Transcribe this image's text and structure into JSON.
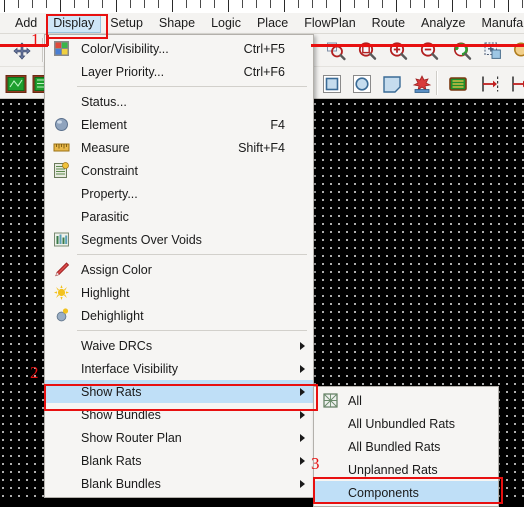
{
  "app": {
    "type": "pcb-layout-editor"
  },
  "menubar": {
    "items": [
      {
        "label": "Add",
        "active": false
      },
      {
        "label": "Display",
        "active": true
      },
      {
        "label": "Setup",
        "active": false
      },
      {
        "label": "Shape",
        "active": false
      },
      {
        "label": "Logic",
        "active": false
      },
      {
        "label": "Place",
        "active": false
      },
      {
        "label": "FlowPlan",
        "active": false
      },
      {
        "label": "Route",
        "active": false
      },
      {
        "label": "Analyze",
        "active": false
      },
      {
        "label": "Manufa",
        "active": false
      }
    ]
  },
  "display_menu": {
    "items": [
      {
        "label": "Color/Visibility...",
        "accel": "Ctrl+F5",
        "icon": "color-palette-icon",
        "submenu": false,
        "selected": false
      },
      {
        "label": "Layer Priority...",
        "accel": "Ctrl+F6",
        "icon": "",
        "submenu": false,
        "selected": false
      },
      {
        "separator": true
      },
      {
        "label": "Status...",
        "accel": "",
        "icon": "",
        "submenu": false,
        "selected": false
      },
      {
        "label": "Element",
        "accel": "F4",
        "icon": "sphere-icon",
        "submenu": false,
        "selected": false
      },
      {
        "label": "Measure",
        "accel": "Shift+F4",
        "icon": "ruler-icon",
        "submenu": false,
        "selected": false
      },
      {
        "label": "Constraint",
        "accel": "",
        "icon": "constraint-table-icon",
        "submenu": false,
        "selected": false
      },
      {
        "label": "Property...",
        "accel": "",
        "icon": "",
        "submenu": false,
        "selected": false
      },
      {
        "label": "Parasitic",
        "accel": "",
        "icon": "",
        "submenu": false,
        "selected": false
      },
      {
        "label": "Segments Over Voids",
        "accel": "",
        "icon": "bars-icon",
        "submenu": false,
        "selected": false
      },
      {
        "separator": true
      },
      {
        "label": "Assign Color",
        "accel": "",
        "icon": "pen-icon",
        "submenu": false,
        "selected": false
      },
      {
        "label": "Highlight",
        "accel": "",
        "icon": "sun-icon",
        "submenu": false,
        "selected": false
      },
      {
        "label": "Dehighlight",
        "accel": "",
        "icon": "dehighlight-icon",
        "submenu": false,
        "selected": false
      },
      {
        "separator": true
      },
      {
        "label": "Waive DRCs",
        "accel": "",
        "icon": "",
        "submenu": true,
        "selected": false
      },
      {
        "label": "Interface Visibility",
        "accel": "",
        "icon": "",
        "submenu": true,
        "selected": false
      },
      {
        "label": "Show Rats",
        "accel": "",
        "icon": "",
        "submenu": true,
        "selected": true
      },
      {
        "label": "Show Bundles",
        "accel": "",
        "icon": "",
        "submenu": true,
        "selected": false
      },
      {
        "label": "Show Router Plan",
        "accel": "",
        "icon": "",
        "submenu": true,
        "selected": false
      },
      {
        "label": "Blank Rats",
        "accel": "",
        "icon": "",
        "submenu": true,
        "selected": false
      },
      {
        "label": "Blank Bundles",
        "accel": "",
        "icon": "",
        "submenu": true,
        "selected": false
      }
    ]
  },
  "show_rats_submenu": {
    "items": [
      {
        "label": "All",
        "icon": "rats-all-icon",
        "selected": false
      },
      {
        "label": "All Unbundled Rats",
        "icon": "",
        "selected": false
      },
      {
        "label": "All Bundled Rats",
        "icon": "",
        "selected": false
      },
      {
        "label": "Unplanned Rats",
        "icon": "",
        "selected": false
      },
      {
        "label": "Components",
        "icon": "",
        "selected": true
      }
    ]
  },
  "annotations": {
    "steps": [
      {
        "number": "1",
        "target": "Display menu"
      },
      {
        "number": "2",
        "target": "Show Rats"
      },
      {
        "number": "3",
        "target": "Components"
      }
    ]
  },
  "toolbar": {
    "row1": [
      {
        "name": "pan-move-icon"
      },
      {
        "name": "zoom-fit-icon"
      },
      {
        "name": "zoom-points-icon"
      },
      {
        "name": "zoom-in-icon"
      },
      {
        "name": "zoom-out-icon"
      },
      {
        "name": "zoom-previous-icon"
      },
      {
        "name": "zoom-world-icon"
      },
      {
        "name": "zoom-selection-icon"
      }
    ],
    "row2": [
      {
        "name": "board-green-1-icon"
      },
      {
        "name": "board-green-2-icon"
      },
      {
        "name": "shape-rect-icon"
      },
      {
        "name": "shape-circle-icon"
      },
      {
        "name": "shape-polygon-icon"
      },
      {
        "name": "shape-delete-icon"
      },
      {
        "name": "component-place-icon"
      },
      {
        "name": "dimension-icon"
      },
      {
        "name": "dimension2-icon"
      }
    ]
  },
  "colors": {
    "accent_red": "#e81010",
    "selection_blue": "#bfdff7",
    "menu_bg": "#f6f5f3",
    "canvas_bg": "#000000"
  }
}
